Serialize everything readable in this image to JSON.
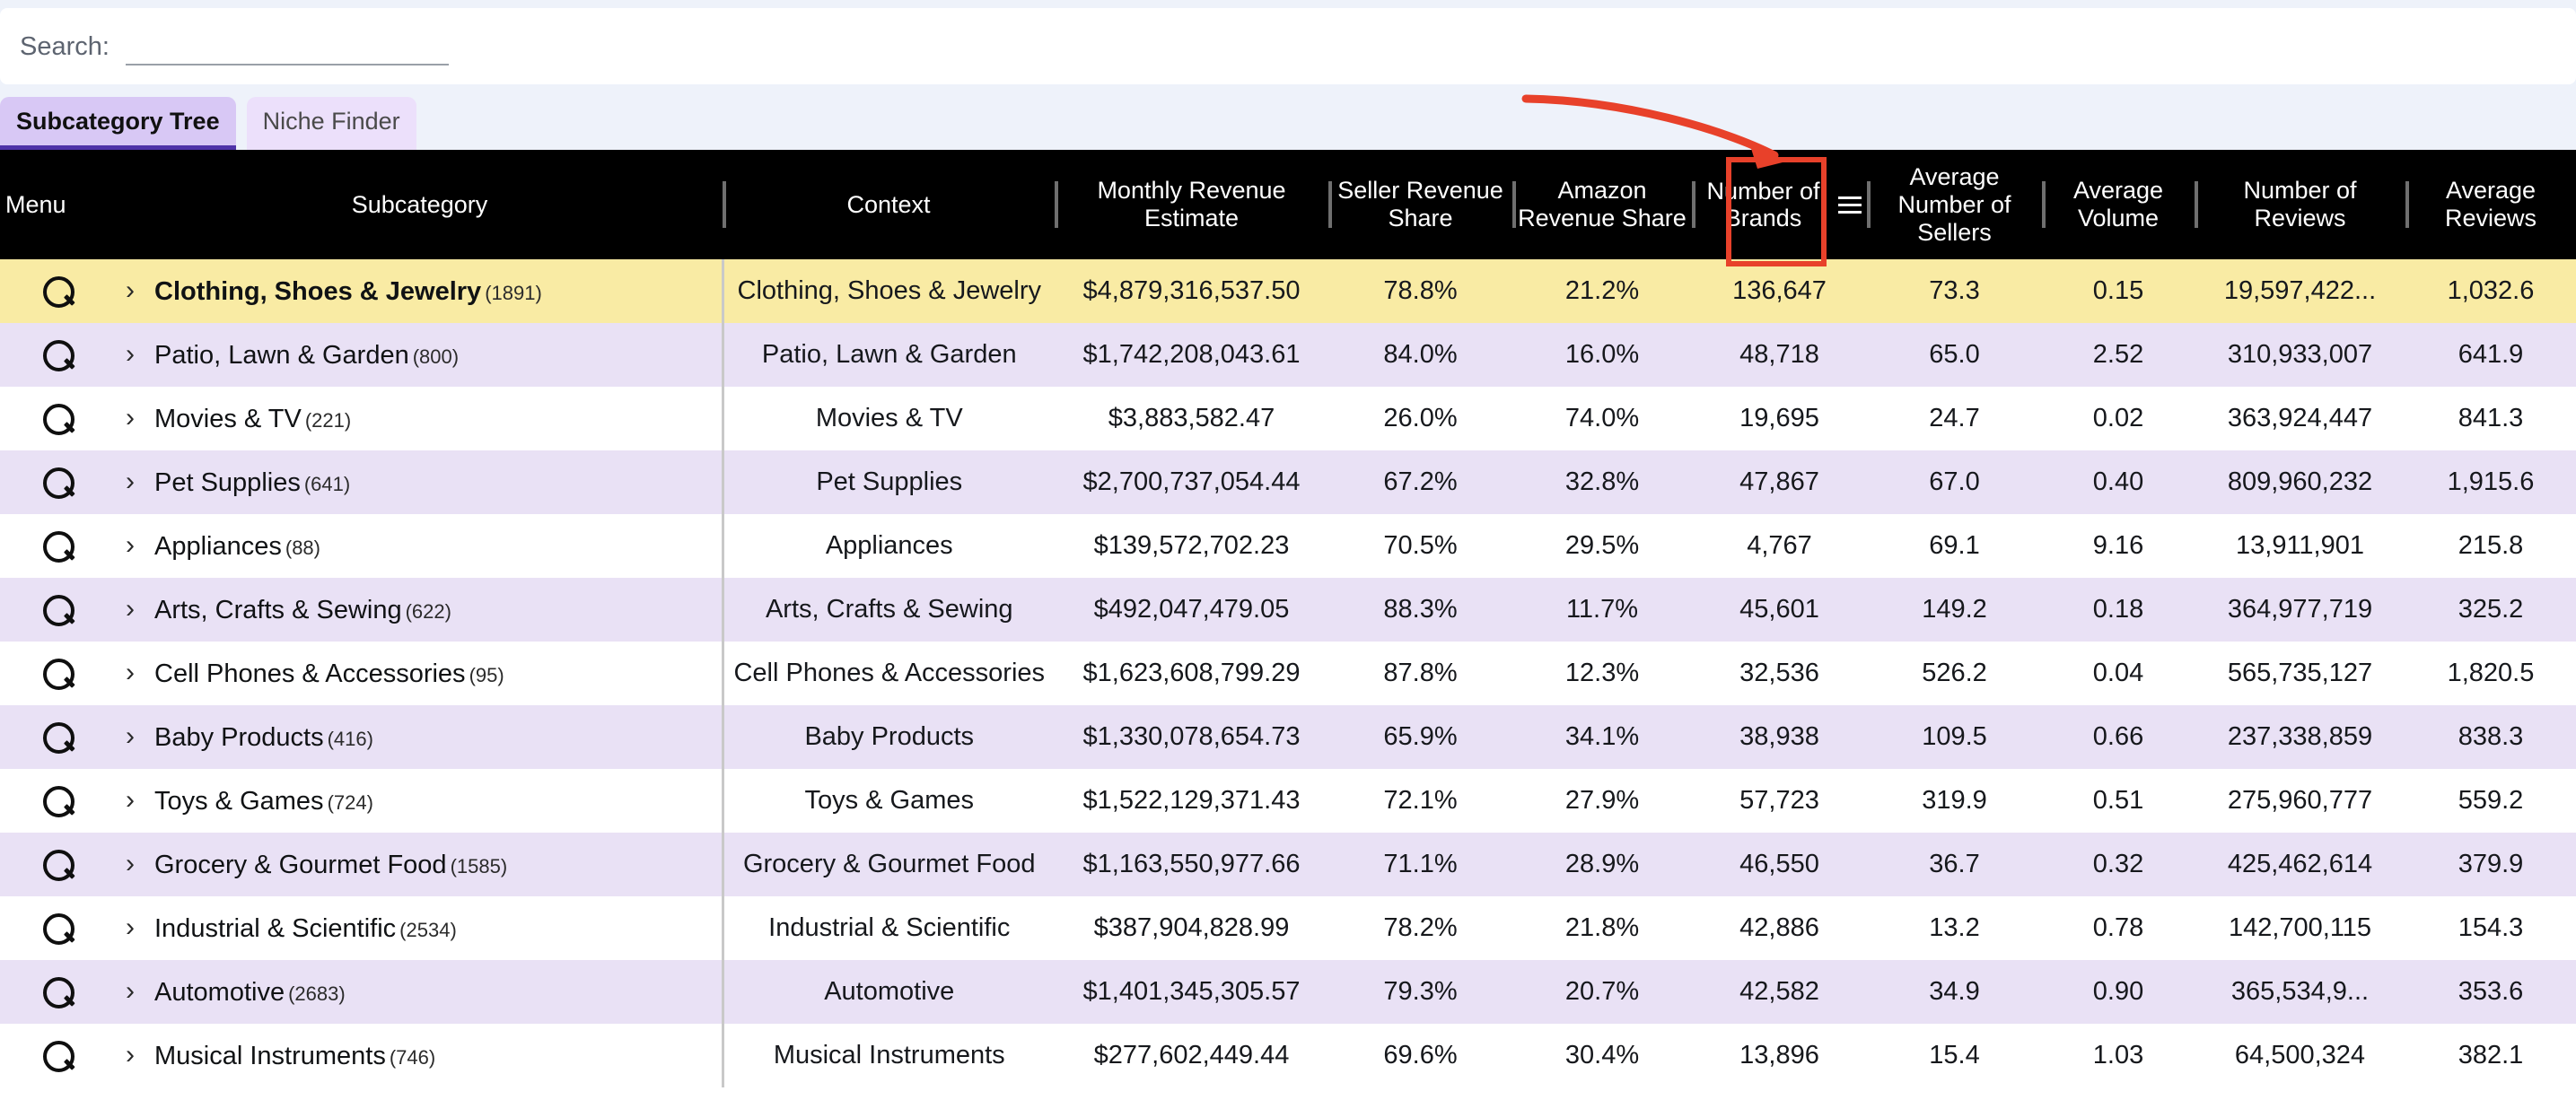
{
  "search": {
    "label": "Search:",
    "value": "",
    "placeholder": ""
  },
  "tabs": [
    {
      "label": "Subcategory Tree",
      "active": true
    },
    {
      "label": "Niche Finder",
      "active": false
    }
  ],
  "table": {
    "columns": [
      {
        "key": "menu",
        "label": "Menu"
      },
      {
        "key": "sub",
        "label": "Subcategory"
      },
      {
        "key": "ctx",
        "label": "Context"
      },
      {
        "key": "mre",
        "label": "Monthly Revenue Estimate"
      },
      {
        "key": "srs",
        "label": "Seller Revenue Share"
      },
      {
        "key": "ars",
        "label": "Amazon Revenue Share"
      },
      {
        "key": "nob",
        "label": "Number of Brands"
      },
      {
        "key": "ans",
        "label": "Average Number of Sellers"
      },
      {
        "key": "avol",
        "label": "Average Volume"
      },
      {
        "key": "nrev",
        "label": "Number of Reviews"
      },
      {
        "key": "arev",
        "label": "Average Reviews"
      }
    ],
    "sorted_column": "Number of Brands",
    "sort_icon": "hamburger-sort-icon",
    "rows": [
      {
        "menu_icon": "magnifier-icon",
        "expander": "›",
        "sub": "Clothing, Shoes & Jewelry",
        "count": "(1891)",
        "ctx": "Clothing, Shoes & Jewelry",
        "mre": "$4,879,316,537.50",
        "srs": "78.8%",
        "ars": "21.2%",
        "nob": "136,647",
        "ans": "73.3",
        "avol": "0.15",
        "nrev": "19,597,422...",
        "arev": "1,032.6",
        "highlight": true
      },
      {
        "menu_icon": "magnifier-icon",
        "expander": "›",
        "sub": "Patio, Lawn & Garden",
        "count": "(800)",
        "ctx": "Patio, Lawn & Garden",
        "mre": "$1,742,208,043.61",
        "srs": "84.0%",
        "ars": "16.0%",
        "nob": "48,718",
        "ans": "65.0",
        "avol": "2.52",
        "nrev": "310,933,007",
        "arev": "641.9",
        "highlight": false
      },
      {
        "menu_icon": "magnifier-icon",
        "expander": "›",
        "sub": "Movies & TV",
        "count": "(221)",
        "ctx": "Movies & TV",
        "mre": "$3,883,582.47",
        "srs": "26.0%",
        "ars": "74.0%",
        "nob": "19,695",
        "ans": "24.7",
        "avol": "0.02",
        "nrev": "363,924,447",
        "arev": "841.3",
        "highlight": false
      },
      {
        "menu_icon": "magnifier-icon",
        "expander": "›",
        "sub": "Pet Supplies",
        "count": "(641)",
        "ctx": "Pet Supplies",
        "mre": "$2,700,737,054.44",
        "srs": "67.2%",
        "ars": "32.8%",
        "nob": "47,867",
        "ans": "67.0",
        "avol": "0.40",
        "nrev": "809,960,232",
        "arev": "1,915.6",
        "highlight": false
      },
      {
        "menu_icon": "magnifier-icon",
        "expander": "›",
        "sub": "Appliances",
        "count": "(88)",
        "ctx": "Appliances",
        "mre": "$139,572,702.23",
        "srs": "70.5%",
        "ars": "29.5%",
        "nob": "4,767",
        "ans": "69.1",
        "avol": "9.16",
        "nrev": "13,911,901",
        "arev": "215.8",
        "highlight": false
      },
      {
        "menu_icon": "magnifier-icon",
        "expander": "›",
        "sub": "Arts, Crafts & Sewing",
        "count": "(622)",
        "ctx": "Arts, Crafts & Sewing",
        "mre": "$492,047,479.05",
        "srs": "88.3%",
        "ars": "11.7%",
        "nob": "45,601",
        "ans": "149.2",
        "avol": "0.18",
        "nrev": "364,977,719",
        "arev": "325.2",
        "highlight": false
      },
      {
        "menu_icon": "magnifier-icon",
        "expander": "›",
        "sub": "Cell Phones & Accessories",
        "count": "(95)",
        "ctx": "Cell Phones & Accessories",
        "mre": "$1,623,608,799.29",
        "srs": "87.8%",
        "ars": "12.3%",
        "nob": "32,536",
        "ans": "526.2",
        "avol": "0.04",
        "nrev": "565,735,127",
        "arev": "1,820.5",
        "highlight": false
      },
      {
        "menu_icon": "magnifier-icon",
        "expander": "›",
        "sub": "Baby Products",
        "count": "(416)",
        "ctx": "Baby Products",
        "mre": "$1,330,078,654.73",
        "srs": "65.9%",
        "ars": "34.1%",
        "nob": "38,938",
        "ans": "109.5",
        "avol": "0.66",
        "nrev": "237,338,859",
        "arev": "838.3",
        "highlight": false
      },
      {
        "menu_icon": "magnifier-icon",
        "expander": "›",
        "sub": "Toys & Games",
        "count": "(724)",
        "ctx": "Toys & Games",
        "mre": "$1,522,129,371.43",
        "srs": "72.1%",
        "ars": "27.9%",
        "nob": "57,723",
        "ans": "319.9",
        "avol": "0.51",
        "nrev": "275,960,777",
        "arev": "559.2",
        "highlight": false
      },
      {
        "menu_icon": "magnifier-icon",
        "expander": "›",
        "sub": "Grocery & Gourmet Food",
        "count": "(1585)",
        "ctx": "Grocery & Gourmet Food",
        "mre": "$1,163,550,977.66",
        "srs": "71.1%",
        "ars": "28.9%",
        "nob": "46,550",
        "ans": "36.7",
        "avol": "0.32",
        "nrev": "425,462,614",
        "arev": "379.9",
        "highlight": false
      },
      {
        "menu_icon": "magnifier-icon",
        "expander": "›",
        "sub": "Industrial & Scientific",
        "count": "(2534)",
        "ctx": "Industrial & Scientific",
        "mre": "$387,904,828.99",
        "srs": "78.2%",
        "ars": "21.8%",
        "nob": "42,886",
        "ans": "13.2",
        "avol": "0.78",
        "nrev": "142,700,115",
        "arev": "154.3",
        "highlight": false
      },
      {
        "menu_icon": "magnifier-icon",
        "expander": "›",
        "sub": "Automotive",
        "count": "(2683)",
        "ctx": "Automotive",
        "mre": "$1,401,345,305.57",
        "srs": "79.3%",
        "ars": "20.7%",
        "nob": "42,582",
        "ans": "34.9",
        "avol": "0.90",
        "nrev": "365,534,9...",
        "arev": "353.6",
        "highlight": false
      },
      {
        "menu_icon": "magnifier-icon",
        "expander": "›",
        "sub": "Musical Instruments",
        "count": "(746)",
        "ctx": "Musical Instruments",
        "mre": "$277,602,449.44",
        "srs": "69.6%",
        "ars": "30.4%",
        "nob": "13,896",
        "ans": "15.4",
        "avol": "1.03",
        "nrev": "64,500,324",
        "arev": "382.1",
        "highlight": false
      }
    ]
  },
  "annotation": {
    "type": "arrow-and-box",
    "color": "#e8412a",
    "target_column": "Number of Brands"
  },
  "colors": {
    "page_background": "#eef2fa",
    "header_background": "#000000",
    "active_tab": "#d8c8f5",
    "inactive_tab": "#ece0fb",
    "tab_underline": "#4f33a8",
    "row_alt": "#e9e1f5",
    "row_highlight": "#f9eba4",
    "annotation": "#e8412a"
  }
}
